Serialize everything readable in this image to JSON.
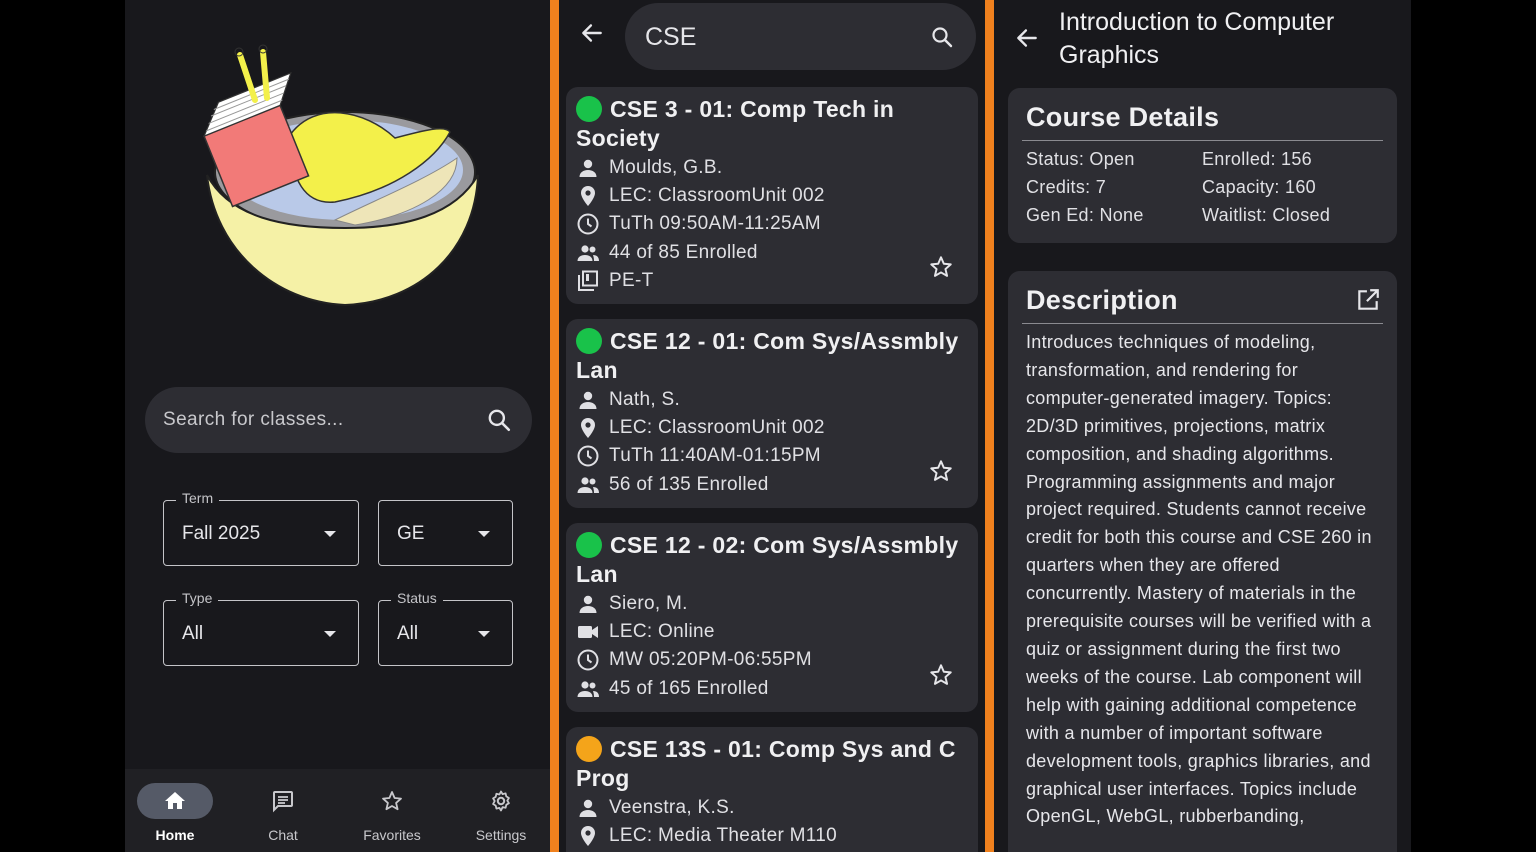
{
  "home": {
    "search_placeholder": "Search for classes...",
    "filters": [
      {
        "label": "Term",
        "value": "Fall 2025"
      },
      {
        "label": "",
        "value": "GE"
      },
      {
        "label": "Type",
        "value": "All"
      },
      {
        "label": "Status",
        "value": "All"
      }
    ],
    "nav": [
      {
        "label": "Home",
        "icon": "home-icon",
        "active": true
      },
      {
        "label": "Chat",
        "icon": "chat-icon",
        "active": false
      },
      {
        "label": "Favorites",
        "icon": "star-icon",
        "active": false
      },
      {
        "label": "Settings",
        "icon": "gear-icon",
        "active": false
      }
    ]
  },
  "results": {
    "query": "CSE",
    "courses": [
      {
        "status": "open",
        "title": "CSE 3 - 01: Comp Tech in Society",
        "instructor": "Moulds, G.B.",
        "location": "LEC: ClassroomUnit 002",
        "time": "TuTh 09:50AM-11:25AM",
        "enrolled": "44 of 85 Enrolled",
        "ge": "PE-T"
      },
      {
        "status": "open",
        "title": "CSE 12 - 01: Com Sys/Assmbly Lan",
        "instructor": "Nath, S.",
        "location": "LEC: ClassroomUnit 002",
        "time": "TuTh 11:40AM-01:15PM",
        "enrolled": "56 of 135 Enrolled"
      },
      {
        "status": "open",
        "title": "CSE 12 - 02: Com Sys/Assmbly Lan",
        "instructor": "Siero, M.",
        "location": "LEC: Online",
        "time": "MW 05:20PM-06:55PM",
        "enrolled": "45 of 165 Enrolled"
      },
      {
        "status": "waitlist",
        "title": "CSE 13S - 01: Comp Sys and C Prog",
        "instructor": "Veenstra, K.S.",
        "location": "LEC: Media Theater M110"
      }
    ]
  },
  "detail": {
    "title": "Introduction to Computer Graphics",
    "details_heading": "Course Details",
    "status": "Status: Open",
    "credits": "Credits: 7",
    "gen_ed": "Gen Ed: None",
    "enrolled": "Enrolled: 156",
    "capacity": "Capacity: 160",
    "waitlist": "Waitlist: Closed",
    "description_heading": "Description",
    "description": "Introduces techniques of modeling, transformation, and rendering for computer-generated imagery. Topics: 2D/3D primitives, projections, matrix composition, and shading algorithms. Programming assignments and major project required. Students cannot receive credit for both this course and CSE 260 in quarters when they are offered concurrently. Mastery of materials in the prerequisite courses will be verified with a quiz or assignment during the first two weeks of the course. Lab component will help with gaining additional competence with a number of important software development tools, graphics libraries, and graphical user interfaces. Topics include OpenGL, WebGL, rubberbanding,"
  },
  "colors": {
    "accent_divider": "#f0811e",
    "status_open": "#19c24a",
    "status_waitlist": "#f4a41a",
    "surface": "#2d2d33",
    "background": "#18181c"
  }
}
